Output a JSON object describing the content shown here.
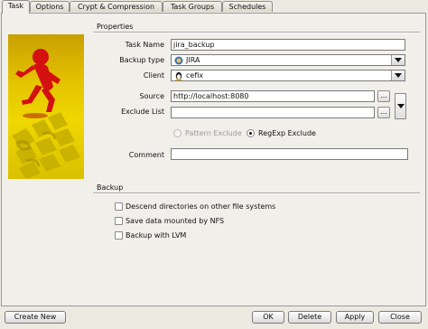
{
  "tabs": [
    {
      "label": "Task",
      "active": true
    },
    {
      "label": "Options",
      "active": false
    },
    {
      "label": "Crypt & Compression",
      "active": false
    },
    {
      "label": "Task Groups",
      "active": false
    },
    {
      "label": "Schedules",
      "active": false
    }
  ],
  "properties": {
    "section_title": "Properties",
    "task_name_label": "Task Name",
    "task_name_value": "jira_backup",
    "backup_type_label": "Backup type",
    "backup_type_value": "JIRA",
    "backup_type_icon": "jira-icon",
    "client_label": "Client",
    "client_value": "cefix",
    "client_icon": "linux-tux-icon",
    "source_label": "Source",
    "source_value": "http://localhost:8080",
    "source_button": "...",
    "exclude_label": "Exclude List",
    "exclude_value": "",
    "exclude_button": "...",
    "exclude_dropdown_icon": "chevron-down-icon",
    "pattern_exclude_label": "Pattern Exclude",
    "pattern_exclude_selected": false,
    "pattern_exclude_enabled": false,
    "regexp_exclude_label": "RegExp Exclude",
    "regexp_exclude_selected": true,
    "comment_label": "Comment",
    "comment_value": ""
  },
  "backup": {
    "section_title": "Backup",
    "options": [
      {
        "label": "Descend directories on other file systems",
        "checked": false
      },
      {
        "label": "Save data mounted by NFS",
        "checked": false
      },
      {
        "label": "Backup with LVM",
        "checked": false
      }
    ]
  },
  "footer": {
    "create_new": "Create New",
    "ok": "OK",
    "delete": "Delete",
    "apply": "Apply",
    "close": "Close"
  },
  "colors": {
    "accent_yellow": "#e8cc00",
    "figure_red": "#d41010"
  }
}
